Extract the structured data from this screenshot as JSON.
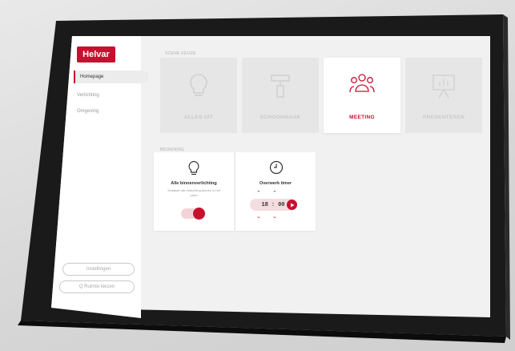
{
  "brand": {
    "logo_text": "Helvar",
    "accent_color": "#c8102e"
  },
  "sidebar": {
    "items": [
      {
        "label": "Homepage",
        "active": true
      },
      {
        "label": "Verlichting",
        "active": false
      },
      {
        "label": "Omgeving",
        "active": false
      }
    ],
    "bottom_buttons": [
      {
        "label": "Instellingen"
      },
      {
        "label": "Q  Ruimte kiezen"
      }
    ]
  },
  "scenes": {
    "section_label": "SCENE KEUZE",
    "cards": [
      {
        "label": "ALLES UIT",
        "icon": "lightbulb-icon",
        "active": false
      },
      {
        "label": "SCHOONMAAK",
        "icon": "paint-roller-icon",
        "active": false
      },
      {
        "label": "MEETING",
        "icon": "people-icon",
        "active": true
      },
      {
        "label": "PRESENTEREN",
        "icon": "presentation-board-icon",
        "active": false
      }
    ]
  },
  "controls": {
    "section_label": "BEDIENING",
    "lighting": {
      "title": "Alle binnenverlichting",
      "subtitle": "Schakelt alle verlichting binnen in het pand",
      "icon": "lightbulb-icon",
      "toggle_on": true
    },
    "timer": {
      "title": "Overwerk timer",
      "icon": "clock-icon",
      "hours": "18",
      "separator": ":",
      "minutes": "00"
    }
  }
}
